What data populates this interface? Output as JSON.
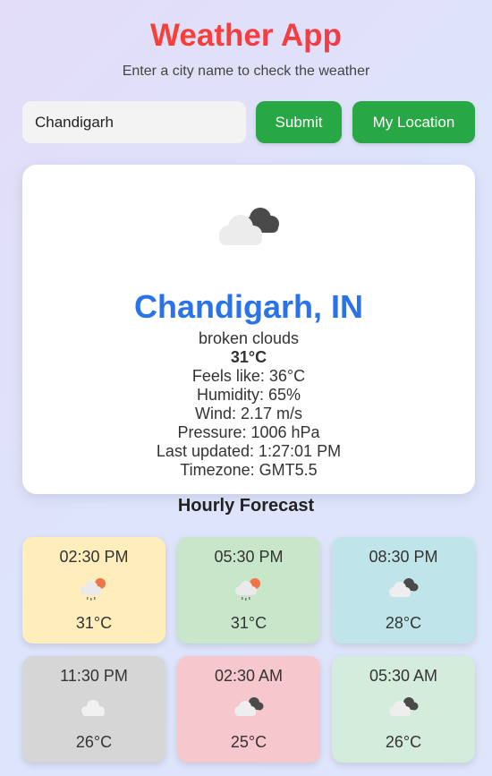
{
  "app": {
    "title": "Weather App",
    "subtitle": "Enter a city name to check the weather"
  },
  "search": {
    "value": "Chandigarh",
    "placeholder": "Enter city name"
  },
  "buttons": {
    "submit": "Submit",
    "location": "My Location"
  },
  "current": {
    "icon": "broken-clouds-icon",
    "city": "Chandigarh, IN",
    "description": "broken clouds",
    "temperature": "31°C",
    "feels_like": "Feels like: 36°C",
    "humidity": "Humidity: 65%",
    "wind": "Wind: 2.17 m/s",
    "pressure": "Pressure: 1006 hPa",
    "last_updated": "Last updated: 1:27:01 PM",
    "timezone": "Timezone: GMT5.5"
  },
  "hourly": {
    "title": "Hourly Forecast",
    "items": [
      {
        "time": "02:30 PM",
        "icon": "sun-rain-icon",
        "temp": "31°C",
        "color": "#ffeebb"
      },
      {
        "time": "05:30 PM",
        "icon": "sun-rain-icon",
        "temp": "31°C",
        "color": "#c8e6c9"
      },
      {
        "time": "08:30 PM",
        "icon": "broken-clouds-icon",
        "temp": "28°C",
        "color": "#bfe4e9"
      },
      {
        "time": "11:30 PM",
        "icon": "cloud-icon",
        "temp": "26°C",
        "color": "#d6d6d6"
      },
      {
        "time": "02:30 AM",
        "icon": "broken-clouds-icon",
        "temp": "25°C",
        "color": "#f6c7cc"
      },
      {
        "time": "05:30 AM",
        "icon": "broken-clouds-icon",
        "temp": "26°C",
        "color": "#d4ecdc"
      }
    ]
  },
  "colors": {
    "title_gradient_start": "#f7442e",
    "title_gradient_end": "#f03a52",
    "button_green": "#28a745",
    "city_blue": "#2a73e8"
  }
}
